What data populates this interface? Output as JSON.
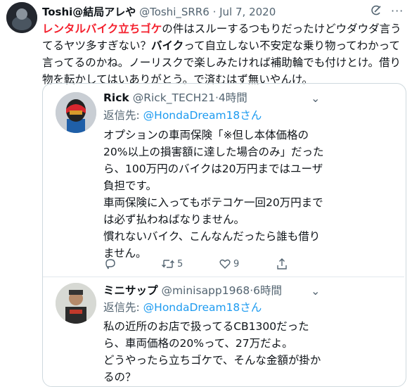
{
  "main_tweet": {
    "display_name": "Toshi@結局アレや",
    "handle": "@Toshi_SRR6",
    "separator": "·",
    "date": "Jul 7, 2020",
    "text_parts": [
      "レンタルバイク立ちゴケ",
      "の件はスルーするつもりだったけどウダウダ言うてるヤツ多すぎない？",
      "バイク",
      "って自立しない不安定な乗り物ってわかって言ってるのかね。ノーリスクで楽しみたければ補助輪でも付けとけ。借り物を転かしてはいありがとう。で済むはず無いやんけ。"
    ]
  },
  "quoted_replies": [
    {
      "display_name": "Rick",
      "handle": "@Rick_TECH21",
      "separator": "·",
      "time": "4時間",
      "reply_prefix": "返信先:",
      "reply_to": "@HondaDream18さん",
      "text": "オプションの車両保険「※但し本体価格の20%以上の損害額に達した場合のみ」だったら、100万円のバイクは20万円まではユーザ負担です。\n車両保険に入ってもボテコケ一回20万円までは必ず払わねばなりません。\n慣れないバイク、こんなんだったら誰も借りません。",
      "actions": {
        "reply": "",
        "retweet": "5",
        "like": "9"
      }
    },
    {
      "display_name": "ミニサップ",
      "handle": "@minisapp1968",
      "separator": "·",
      "time": "6時間",
      "reply_prefix": "返信先:",
      "reply_to": "@HondaDream18さん",
      "text": "私の近所のお店で扱ってるCB1300だったら、車両価格の20%って、27万だよ。\nどうやったら立ちゴケで、そんな金額が掛かるの？"
    }
  ],
  "icons": [
    "grok-icon",
    "more-icon",
    "chevron-down-icon",
    "reply-icon",
    "retweet-icon",
    "like-icon",
    "share-icon"
  ],
  "colors": {
    "link": "#1d9bf0",
    "highlight": "#f4212e",
    "secondary_text": "#536471",
    "border": "#cfd9de"
  }
}
